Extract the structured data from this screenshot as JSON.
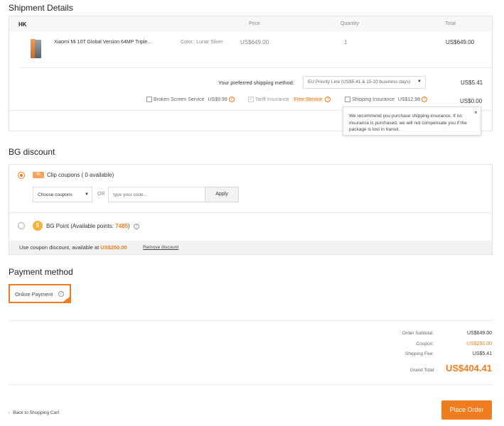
{
  "shipment": {
    "title": "Shipment Details",
    "warehouse": "HK",
    "col_price": "Price",
    "col_quantity": "Quantity",
    "col_total": "Total",
    "product": {
      "name": "Xiaomi Mi 10T Global Version 64MP Triple...",
      "color": "Color.: Lunar Silver",
      "price": "US$649.00",
      "quantity": "1",
      "total": "US$649.00"
    },
    "shipping_label": "Your preferred shipping method:",
    "shipping_value": "EU Priority Line (US$5.41 & 15-20 business days)",
    "shipping_cost": "US$5.41",
    "broken_screen_label": "Broken Screen Service",
    "broken_screen_price": "US$9.99",
    "tariff_label": "Tariff Insurance",
    "tariff_badge": "Free Service",
    "shipping_ins_label": "Shipping Insurance",
    "shipping_ins_price": "US$12.98",
    "services_total": "US$0.00",
    "tooltip": "We recommend you purchase shipping insurance. If no insurance is purchased, we will not compensate you if the package is lost in transit.",
    "tooltip_close": "×"
  },
  "discount": {
    "title": "BG discount",
    "clip_label": "Clip coupons ( 0 available)",
    "choose_coupons": "Choose coupons",
    "or": "OR",
    "code_placeholder": "type your code...",
    "apply": "Apply",
    "point_label": "BG Point (Available points: ",
    "point_value": "7485",
    "point_close": ")",
    "footer_text": "Use coupon discount, available at",
    "footer_amount": "US$250.00",
    "remove": "Remove discount"
  },
  "payment": {
    "title": "Payment method",
    "online": "Online Payment"
  },
  "summary": {
    "subtotal_label": "Order Subtotal:",
    "subtotal_value": "US$649.00",
    "coupon_label": "Coupon:",
    "coupon_value": "-US$250.00",
    "shipping_label": "Shipping Fee:",
    "shipping_value": "US$5.41",
    "grand_label": "Grand Total:",
    "grand_value": "US$404.41"
  },
  "footer": {
    "back": "Back to Shopping Cart",
    "place_order": "Place Order"
  },
  "colors": {
    "accent": "#f07c1d",
    "border": "#e3e3e3"
  }
}
